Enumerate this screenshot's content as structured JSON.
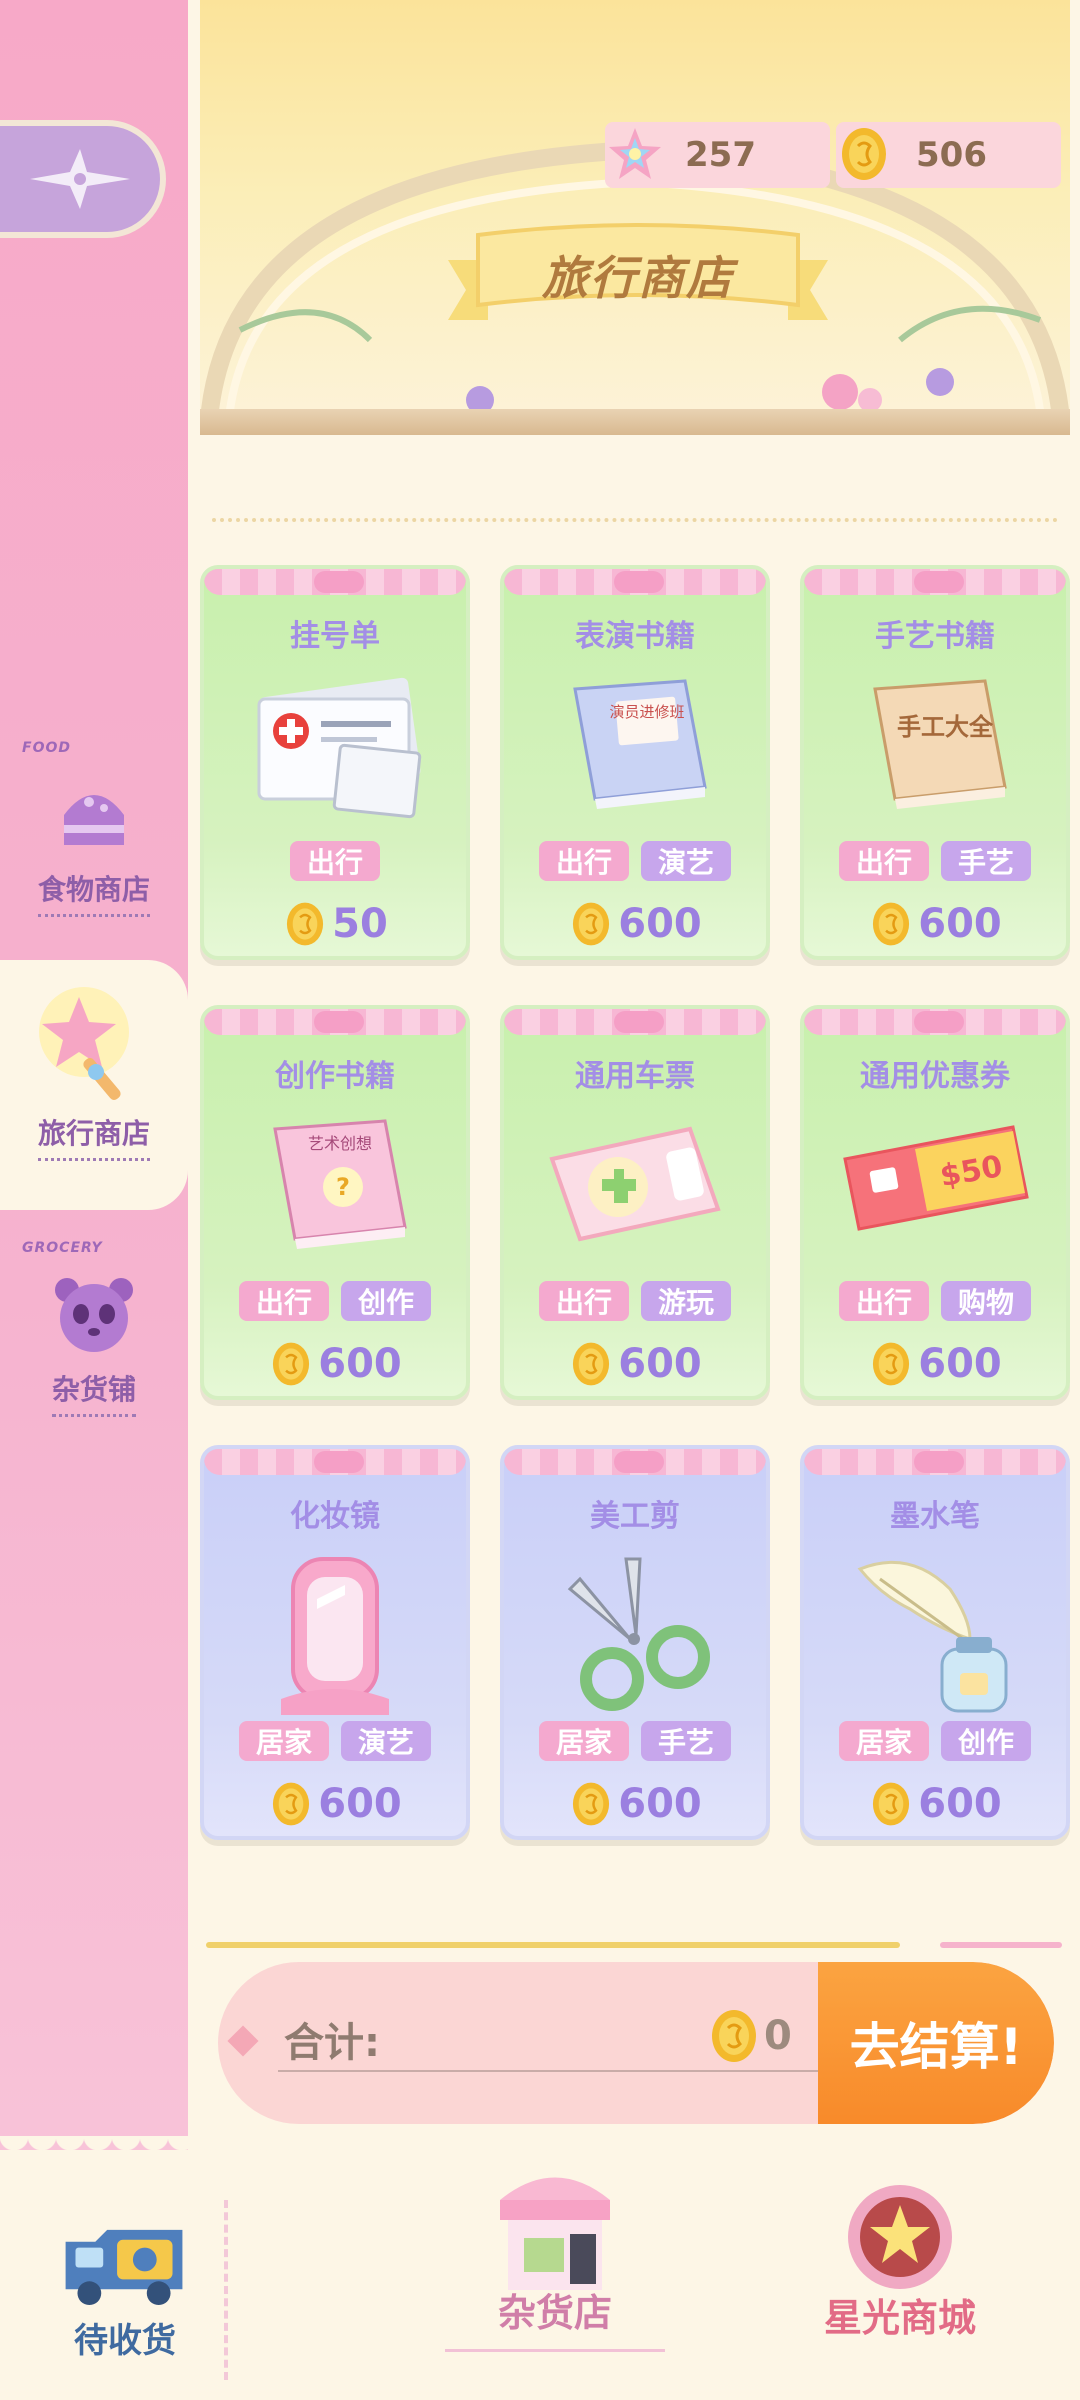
{
  "header": {
    "title": "旅行商店",
    "currency": {
      "stars": "257",
      "coins": "506"
    }
  },
  "sidebar": {
    "tabs": [
      {
        "tag": "FOOD",
        "label": "食物商店",
        "active": false
      },
      {
        "tag": "",
        "label": "旅行商店",
        "active": true
      },
      {
        "tag": "GROCERY",
        "label": "杂货铺",
        "active": false
      }
    ]
  },
  "items": [
    {
      "name": "挂号单",
      "tags": [
        "出行"
      ],
      "price": "50",
      "color": "green",
      "icon": "registration-form-icon"
    },
    {
      "name": "表演书籍",
      "tags": [
        "出行",
        "演艺"
      ],
      "price": "600",
      "color": "green",
      "icon": "performance-book-icon",
      "cover_text": "演员进修班"
    },
    {
      "name": "手艺书籍",
      "tags": [
        "出行",
        "手艺"
      ],
      "price": "600",
      "color": "green",
      "icon": "craft-book-icon",
      "cover_text": "手工大全"
    },
    {
      "name": "创作书籍",
      "tags": [
        "出行",
        "创作"
      ],
      "price": "600",
      "color": "green",
      "icon": "creation-book-icon",
      "cover_text": "艺术创想"
    },
    {
      "name": "通用车票",
      "tags": [
        "出行",
        "游玩"
      ],
      "price": "600",
      "color": "green",
      "icon": "ticket-icon"
    },
    {
      "name": "通用优惠券",
      "tags": [
        "出行",
        "购物"
      ],
      "price": "600",
      "color": "green",
      "icon": "coupon-icon",
      "coupon_text": "$50"
    },
    {
      "name": "化妆镜",
      "tags": [
        "居家",
        "演艺"
      ],
      "price": "600",
      "color": "blue",
      "icon": "mirror-icon"
    },
    {
      "name": "美工剪",
      "tags": [
        "居家",
        "手艺"
      ],
      "price": "600",
      "color": "blue",
      "icon": "scissors-icon"
    },
    {
      "name": "墨水笔",
      "tags": [
        "居家",
        "创作"
      ],
      "price": "600",
      "color": "blue",
      "icon": "quill-pen-icon"
    }
  ],
  "cart": {
    "total_label": "合计:",
    "total_value": "0",
    "checkout_label": "去结算!"
  },
  "bottom_nav": {
    "pending_label": "待收货",
    "grocery_label": "杂货店",
    "star_mall_label": "星光商城"
  },
  "colors": {
    "sidebar_pink": "#f7a9c8",
    "accent_orange": "#f88a2a",
    "price_purple": "#9b7fe0",
    "tag_pink": "#f4a9cf",
    "tag_purple": "#c7a6ec"
  }
}
